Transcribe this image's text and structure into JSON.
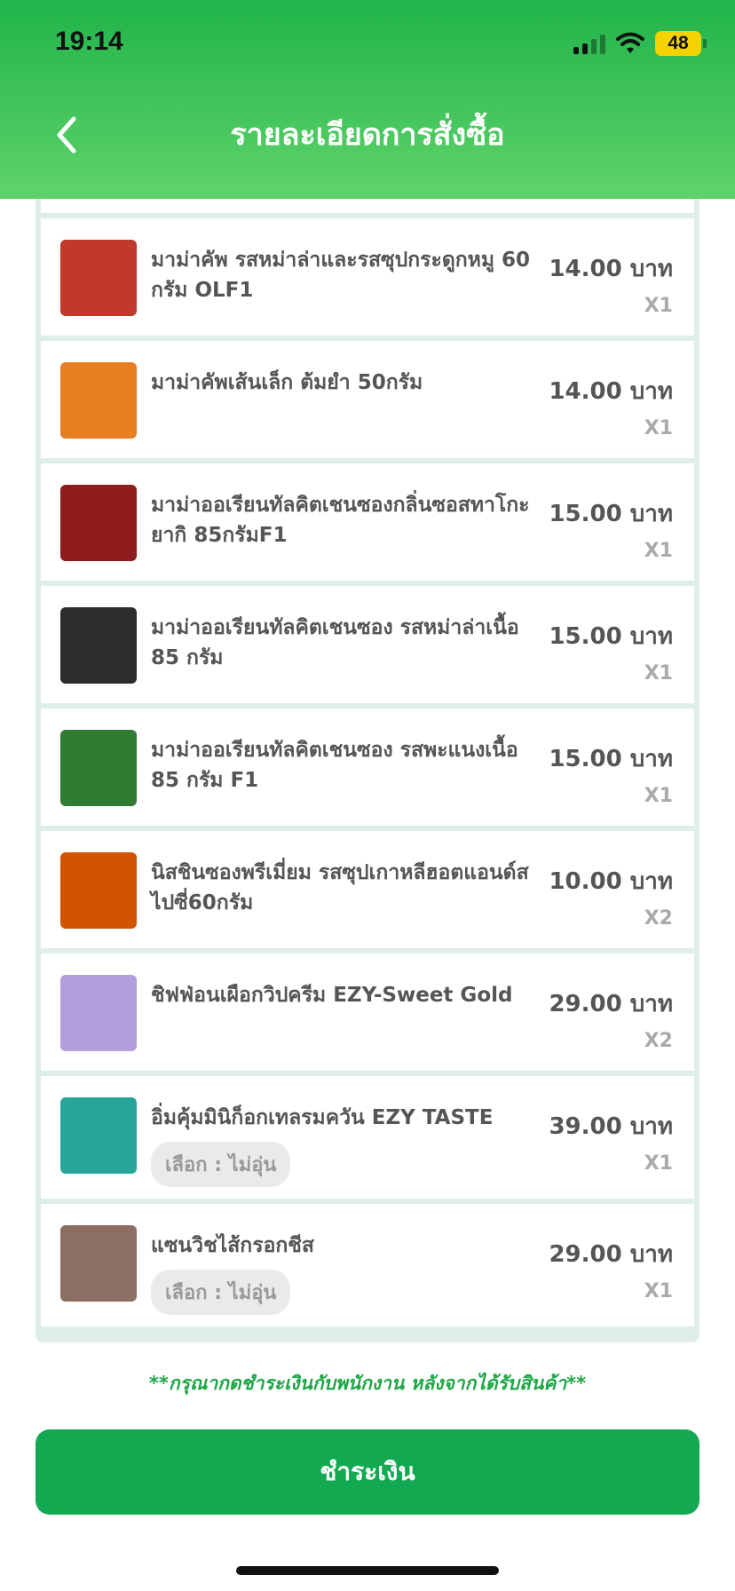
{
  "status_bar": {
    "time": "19:14",
    "battery": "48"
  },
  "header": {
    "title": "รายละเอียดการสั่งซื้อ",
    "back_icon": "chevron-left-icon"
  },
  "items": [
    {
      "name": "มาม่าคัพ รสหม่าล่าและรสซุปกระดูกหมู 60 กรัม OLF1",
      "price": "14.00 บาท",
      "qty": "X1",
      "thumb_color": "#c0392b"
    },
    {
      "name": "มาม่าคัพเส้นเล็ก ต้มยำ 50กรัม",
      "price": "14.00 บาท",
      "qty": "X1",
      "thumb_color": "#e67e22"
    },
    {
      "name": "มาม่าออเรียนทัลคิตเชนซองกลิ่นซอสทาโกะยากิ 85กรัมF1",
      "price": "15.00 บาท",
      "qty": "X1",
      "thumb_color": "#8e1c1c"
    },
    {
      "name": "มาม่าออเรียนทัลคิตเชนซอง รสหม่าล่าเนื้อ 85 กรัม",
      "price": "15.00 บาท",
      "qty": "X1",
      "thumb_color": "#2c2c2c"
    },
    {
      "name": "มาม่าออเรียนทัลคิตเชนซอง รสพะแนงเนื้อ 85 กรัม F1",
      "price": "15.00 บาท",
      "qty": "X1",
      "thumb_color": "#2e7d32"
    },
    {
      "name": "นิสชินซองพรีเมี่ยม รสซุปเกาหลีฮอตแอนด์สไปซี่60กรัม",
      "price": "10.00 บาท",
      "qty": "X2",
      "thumb_color": "#d35400"
    },
    {
      "name": "ชิฟฟ่อนเผือกวิปครีม EZY-Sweet Gold",
      "price": "29.00 บาท",
      "qty": "X2",
      "thumb_color": "#b39ddb"
    },
    {
      "name": "อิ่มคุ้มมินิก็อกเทลรมควัน EZY TASTE",
      "price": "39.00 บาท",
      "qty": "X1",
      "option": "เลือก : ไม่อุ่น",
      "thumb_color": "#26a69a"
    },
    {
      "name": "แซนวิชไส้กรอกชีส",
      "price": "29.00 บาท",
      "qty": "X1",
      "option": "เลือก : ไม่อุ่น",
      "thumb_color": "#8d6e63"
    }
  ],
  "footer": {
    "note": "**กรุณากดชำระเงินกับพนักงาน หลังจากได้รับสินค้า**",
    "pay_label": "ชำระเงิน"
  }
}
